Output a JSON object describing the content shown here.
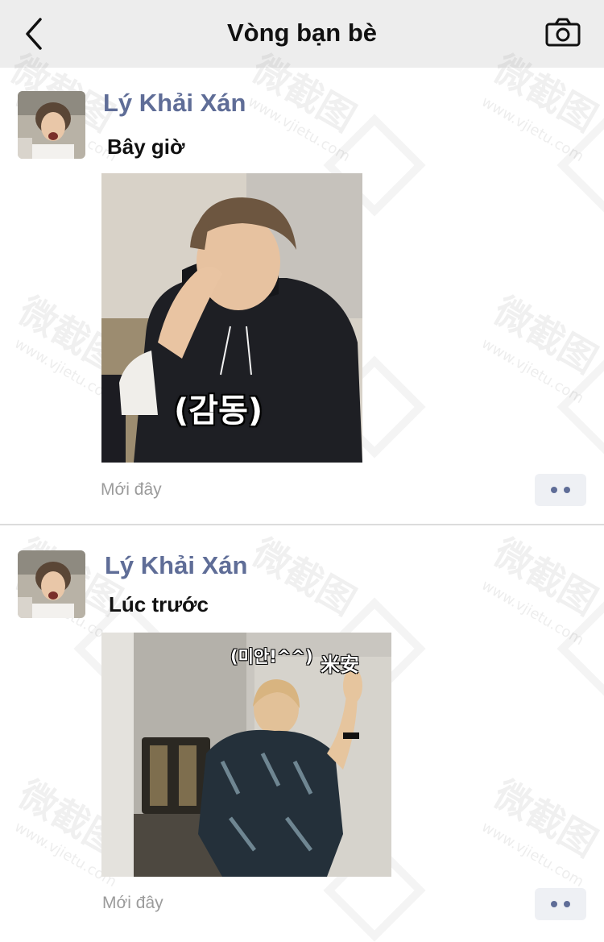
{
  "header": {
    "title": "Vòng bạn bè",
    "back_icon": "chevron-left-icon",
    "camera_icon": "camera-icon"
  },
  "watermark": {
    "chars": "微截图",
    "url": "www.vjietu.com"
  },
  "posts": [
    {
      "username": "Lý Khải Xán",
      "text": "Bây giờ",
      "image_caption": "(감동)",
      "time": "Mới đây"
    },
    {
      "username": "Lý Khải Xán",
      "text": "Lúc trước",
      "image_caption": "(미안!^^)",
      "image_caption_2": "米安",
      "time": "Mới đây"
    }
  ],
  "colors": {
    "header_bg": "#ededed",
    "username": "#5f6d97",
    "time": "#9b9b9b",
    "more_button_bg": "#eef0f4"
  }
}
